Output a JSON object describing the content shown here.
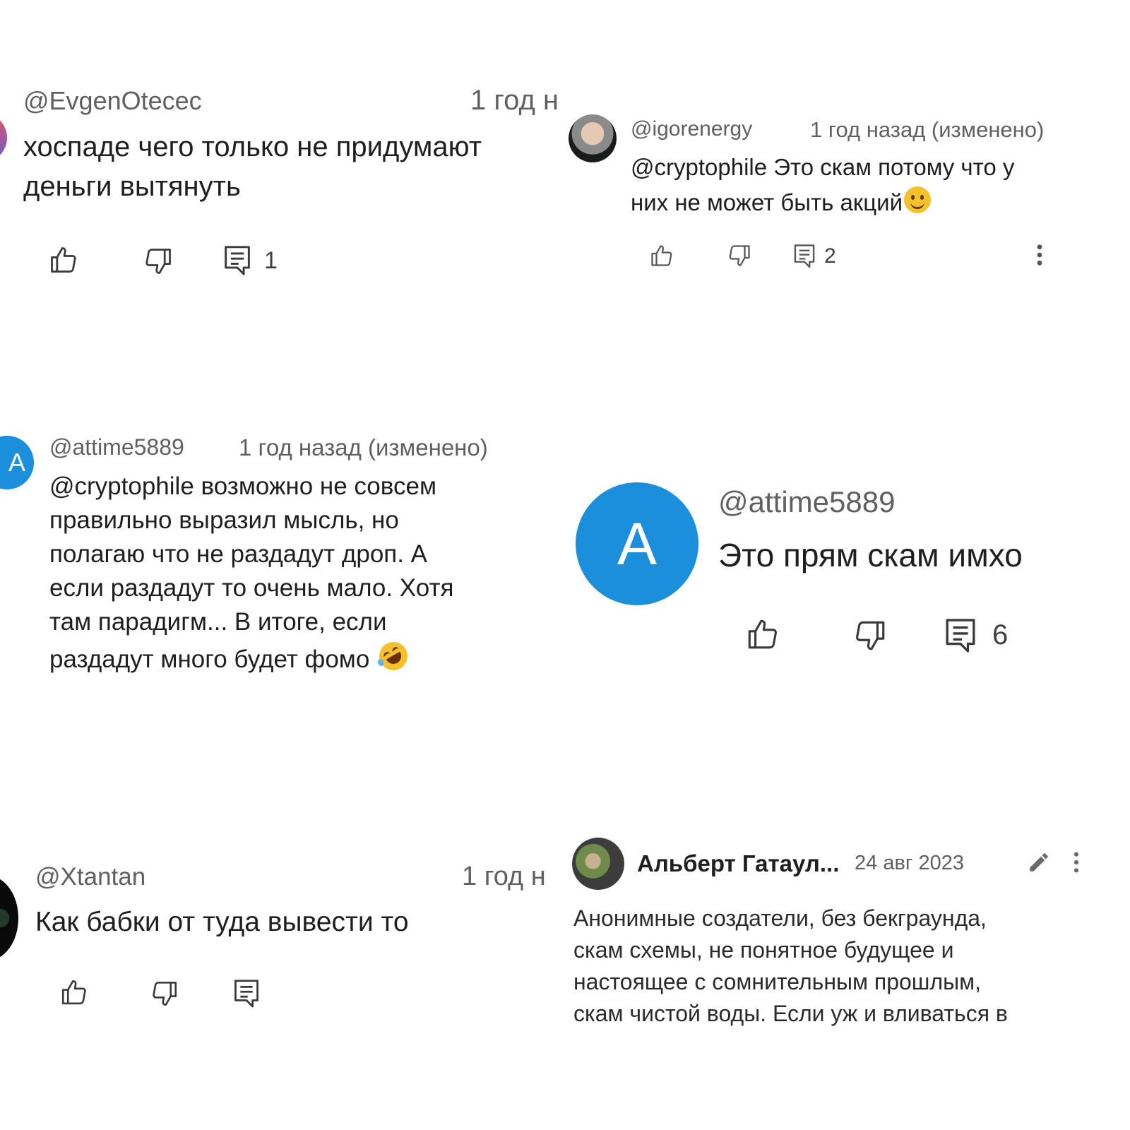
{
  "colors": {
    "avatar_blue": "#1c8fdc",
    "text_dark": "#1f1f1f",
    "text_muted": "#606060",
    "emoji_yellow": "#f6c02c"
  },
  "comments": [
    {
      "handle": "@EvgenOtecec",
      "time": "1 год н",
      "text_lines": [
        "хоспаде чего только не придумают",
        "деньги вытянуть"
      ],
      "reply_count": "1",
      "icons": [
        "thumbs-up-icon",
        "thumbs-down-icon",
        "reply-icon"
      ]
    },
    {
      "handle": "@igorenergy",
      "time": "1 год назад (изменено)",
      "text_lines": [
        "@cryptophile Это скам потому что у",
        "них не может быть акций"
      ],
      "emoji": "slightly-smiling-face",
      "reply_count": "2",
      "icons": [
        "thumbs-up-icon",
        "thumbs-down-icon",
        "reply-icon",
        "more-vert-icon"
      ]
    },
    {
      "handle": "@attime5889",
      "avatar_letter": "A",
      "time": "1 год назад (изменено)",
      "text_lines": [
        "@cryptophile возможно не совсем",
        "правильно выразил мысль, но",
        "полагаю что не раздадут дроп. А",
        "если раздадут то очень мало. Хотя",
        "там парадигм... В итоге, если",
        "раздадут много будет фомо"
      ],
      "emoji": "rolling-on-floor-laughing"
    },
    {
      "handle": "@attime5889",
      "avatar_letter": "A",
      "text": "Это прям скам имхо",
      "reply_count": "6",
      "icons": [
        "thumbs-up-icon",
        "thumbs-down-icon",
        "reply-icon"
      ]
    },
    {
      "handle": "@Xtantan",
      "time": "1 год н",
      "text": "Как бабки от туда вывести то",
      "icons": [
        "thumbs-up-icon",
        "thumbs-down-icon",
        "reply-icon"
      ]
    },
    {
      "author": "Альберт Гатаул...",
      "date": "24 авг 2023",
      "text_lines": [
        "Анонимные создатели, без бекграунда,",
        "скам схемы, не понятное будущее и",
        "настоящее с сомнительным прошлым,",
        "скам чистой воды. Если уж и вливаться в"
      ],
      "icons": [
        "pencil-icon",
        "more-vert-icon"
      ]
    }
  ]
}
